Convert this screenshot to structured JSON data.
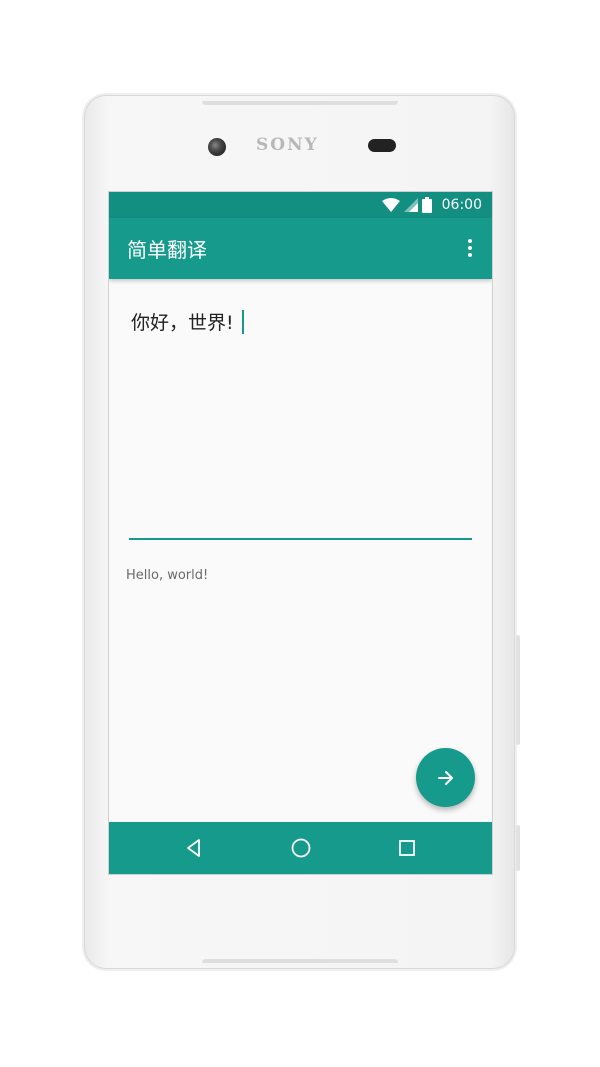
{
  "device": {
    "brand": "SONY"
  },
  "status_bar": {
    "time": "06:00",
    "icons": [
      "wifi-icon",
      "cell-signal-icon",
      "battery-icon"
    ]
  },
  "app_bar": {
    "title": "简单翻译",
    "overflow_icon": "more-vert-icon"
  },
  "editor": {
    "input_value": "你好，世界!",
    "output_text": "Hello, world!"
  },
  "fab": {
    "icon": "arrow-right-icon"
  },
  "nav_bar": {
    "buttons": [
      "back-icon",
      "home-icon",
      "recents-icon"
    ]
  },
  "colors": {
    "primary": "#169a8c",
    "primary_dark": "#138f82",
    "background": "#fafafa",
    "device_body": "#f4f4f4"
  }
}
